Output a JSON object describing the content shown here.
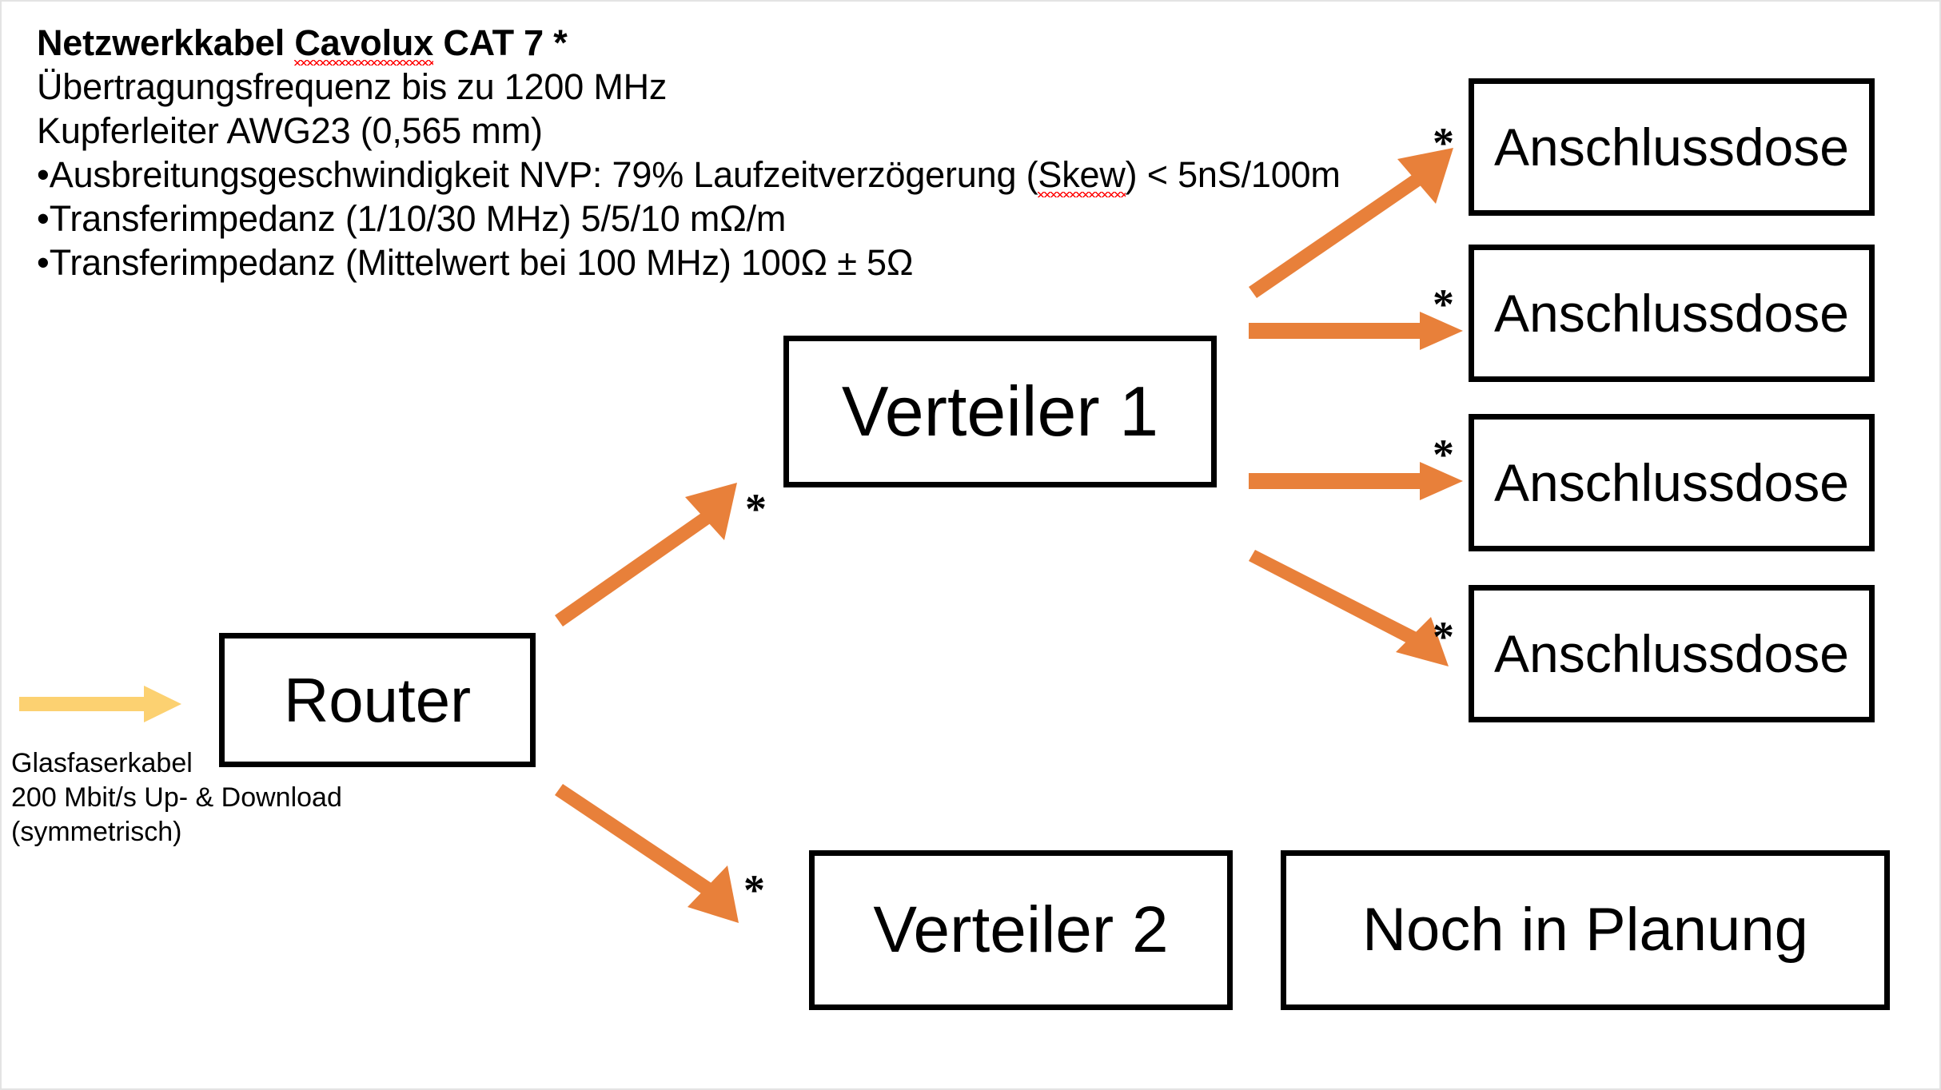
{
  "slide": {
    "background_color": "#ffffff",
    "border_color": "#e3e3e3"
  },
  "spec_block": {
    "title": "Netzwerkkabel Cavolux CAT 7 *",
    "title_prefix": "Netzwerkkabel ",
    "title_misspelled_word": "Cavolux",
    "title_suffix": " CAT 7 *",
    "lines": [
      "Übertragungsfrequenz bis zu 1200 MHz",
      "Kupferleiter AWG23 (0,565 mm)"
    ],
    "bullets": [
      {
        "prefix": "Ausbreitungsgeschwindigkeit NVP: 79% Laufzeitverzögerung (",
        "misspelled_word": "Skew",
        "suffix": ") < 5nS/100m"
      },
      {
        "prefix": "Transferimpedanz (1/10/30 MHz) 5/5/10 mΩ/m",
        "misspelled_word": "",
        "suffix": ""
      },
      {
        "prefix": "Transferimpedanz (Mittelwert bei 100 MHz) 100Ω ± 5Ω",
        "misspelled_word": "",
        "suffix": ""
      }
    ],
    "bullet_char": "•"
  },
  "nodes": {
    "router": "Router",
    "verteiler_1": "Verteiler 1",
    "verteiler_2": "Verteiler 2",
    "noch_in_planung": "Noch in Planung",
    "anschlussdosen": [
      "Anschlussdose",
      "Anschlussdose",
      "Anschlussdose",
      "Anschlussdose"
    ]
  },
  "fiber_caption": {
    "line_1": "Glasfaserkabel",
    "line_2": "200 Mbit/s Up- & Download",
    "line_3": "(symmetrisch)"
  },
  "markers": {
    "asterisk": "*",
    "count": 6
  },
  "colors": {
    "orange_arrow": "#e8803a",
    "yellow_arrow": "#fcd171",
    "box_border": "#000000",
    "text": "#000000",
    "spellcheck_underline": "#ff0000"
  }
}
